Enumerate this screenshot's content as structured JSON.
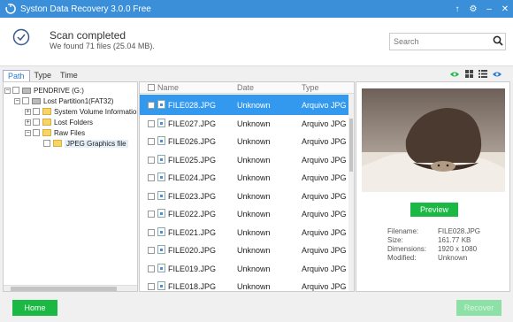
{
  "app": {
    "title": "Syston Data Recovery 3.0.0 Free",
    "controls": {
      "pin": "↑",
      "settings": "⚙",
      "minimize": "‒",
      "close": "✕"
    }
  },
  "header": {
    "status_title": "Scan completed",
    "status_sub": "We found 71 files (25.04 MB).",
    "search_placeholder": "Search"
  },
  "tabs": [
    {
      "label": "Path"
    },
    {
      "label": "Type"
    },
    {
      "label": "Time"
    }
  ],
  "tree": [
    {
      "label": "PENDRIVE (G:)",
      "expander": "−"
    },
    {
      "label": "Lost Partition1(FAT32)",
      "expander": "−"
    },
    {
      "label": "System Volume Information",
      "expander": "+"
    },
    {
      "label": "Lost Folders",
      "expander": "+"
    },
    {
      "label": "Raw Files",
      "expander": "−"
    },
    {
      "label": "JPEG Graphics file",
      "expander": ""
    }
  ],
  "list": {
    "columns": {
      "name": "Name",
      "date": "Date",
      "type": "Type"
    },
    "rows": [
      {
        "name": "FILE028.JPG",
        "date": "Unknown",
        "type": "Arquivo JPG"
      },
      {
        "name": "FILE027.JPG",
        "date": "Unknown",
        "type": "Arquivo JPG"
      },
      {
        "name": "FILE026.JPG",
        "date": "Unknown",
        "type": "Arquivo JPG"
      },
      {
        "name": "FILE025.JPG",
        "date": "Unknown",
        "type": "Arquivo JPG"
      },
      {
        "name": "FILE024.JPG",
        "date": "Unknown",
        "type": "Arquivo JPG"
      },
      {
        "name": "FILE023.JPG",
        "date": "Unknown",
        "type": "Arquivo JPG"
      },
      {
        "name": "FILE022.JPG",
        "date": "Unknown",
        "type": "Arquivo JPG"
      },
      {
        "name": "FILE021.JPG",
        "date": "Unknown",
        "type": "Arquivo JPG"
      },
      {
        "name": "FILE020.JPG",
        "date": "Unknown",
        "type": "Arquivo JPG"
      },
      {
        "name": "FILE019.JPG",
        "date": "Unknown",
        "type": "Arquivo JPG"
      },
      {
        "name": "FILE018.JPG",
        "date": "Unknown",
        "type": "Arquivo JPG"
      }
    ]
  },
  "preview": {
    "button": "Preview",
    "labels": {
      "filename": "Filename:",
      "size": "Size:",
      "dimensions": "Dimensions:",
      "modified": "Modified:"
    },
    "values": {
      "filename": "FILE028.JPG",
      "size": "161.77 KB",
      "dimensions": "1920 x 1080",
      "modified": "Unknown"
    }
  },
  "footer": {
    "home": "Home",
    "recover": "Recover"
  },
  "colors": {
    "accent": "#3399ee",
    "titlebar": "#3a8fd8",
    "green": "#1bb843"
  },
  "icons": [
    "app-logo-icon",
    "check-circle-icon",
    "search-icon",
    "eye-icon",
    "grid-icon",
    "list-icon",
    "file-image-icon",
    "folder-icon",
    "drive-icon"
  ]
}
